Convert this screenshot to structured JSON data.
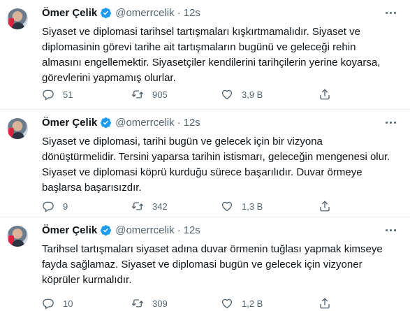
{
  "tweets": [
    {
      "author_name": "Ömer Çelik",
      "handle": "@omerrcelik",
      "separator": "·",
      "time": "12s",
      "text_lines": [
        "Siyaset ve diplomasi tarihsel tartışmaları kışkırtmamalıdır. Siyaset ve",
        "diplomasinin görevi tarihe ait tartışmaların bugünü ve geleceği rehin",
        "almasını engellemektir. Siyasetçiler kendilerini tarihçilerin yerine koyarsa,",
        "görevlerini yapmamış olurlar."
      ],
      "replies": "51",
      "retweets": "905",
      "likes": "3,9 B"
    },
    {
      "author_name": "Ömer Çelik",
      "handle": "@omerrcelik",
      "separator": "·",
      "time": "12s",
      "text_lines": [
        "Siyaset ve diplomasi, tarihi bugün ve gelecek için bir vizyona",
        "dönüştürmelidir. Tersini yaparsa tarihin istismarı, geleceğin mengenesi olur.",
        "Siyaset ve diplomasi köprü kurduğu sürece başarılıdır. Duvar örmeye",
        "başlarsa başarısızdır."
      ],
      "replies": "9",
      "retweets": "342",
      "likes": "1,3 B"
    },
    {
      "author_name": "Ömer Çelik",
      "handle": "@omerrcelik",
      "separator": "·",
      "time": "12s",
      "text_lines": [
        "Tarihsel tartışmaları siyaset adına duvar örmenin tuğlası yapmak kimseye",
        "fayda sağlamaz. Siyaset ve diplomasi bugün ve gelecek için vizyoner",
        "köprüler kurmalıdır."
      ],
      "replies": "10",
      "retweets": "309",
      "likes": "1,2 B"
    }
  ],
  "colors": {
    "text": "#0f1419",
    "secondary": "#536471",
    "verified": "#1d9bf0",
    "divider": "#e7ecf0"
  },
  "icons": [
    "verified-badge-icon",
    "more-options-icon",
    "reply-icon",
    "retweet-icon",
    "like-icon",
    "share-icon"
  ]
}
